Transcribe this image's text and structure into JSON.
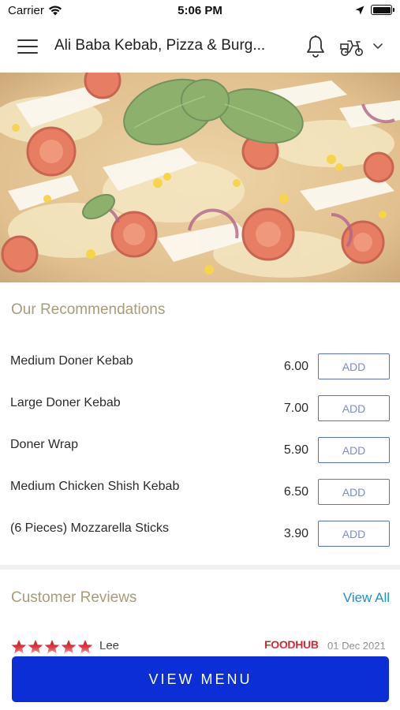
{
  "status_bar": {
    "carrier": "Carrier",
    "time": "5:06 PM"
  },
  "header": {
    "title": "Ali Baba Kebab, Pizza & Burg...",
    "icons": [
      "menu-icon",
      "bell-icon",
      "delivery-scooter-icon",
      "chevron-down-icon"
    ]
  },
  "hero": {
    "image": "pizza-with-basil-tomato-cheese"
  },
  "recommendations": {
    "title": "Our Recommendations",
    "items": [
      {
        "name": "Medium Doner Kebab",
        "price": "6.00",
        "button": "ADD"
      },
      {
        "name": "Large Doner Kebab",
        "price": "7.00",
        "button": "ADD"
      },
      {
        "name": "Doner Wrap",
        "price": "5.90",
        "button": "ADD"
      },
      {
        "name": "Medium Chicken Shish Kebab",
        "price": "6.50",
        "button": "ADD"
      },
      {
        "name": "(6 Pieces) Mozzarella Sticks",
        "price": "3.90",
        "button": "ADD"
      }
    ]
  },
  "reviews": {
    "title": "Customer Reviews",
    "view_all": "View All",
    "items": [
      {
        "reviewer": "Lee",
        "source": "FOODHUB",
        "date": "01 Dec 2021",
        "rating": 5
      }
    ]
  },
  "cta": {
    "label": "VIEW MENU"
  },
  "colors": {
    "accent_blue": "#0b2ed6",
    "add_border": "#5a6fd6",
    "section_title": "#a99c78",
    "link": "#1f8fd0",
    "star_red": "#d7262e",
    "foodhub_red": "#d21f2b"
  }
}
